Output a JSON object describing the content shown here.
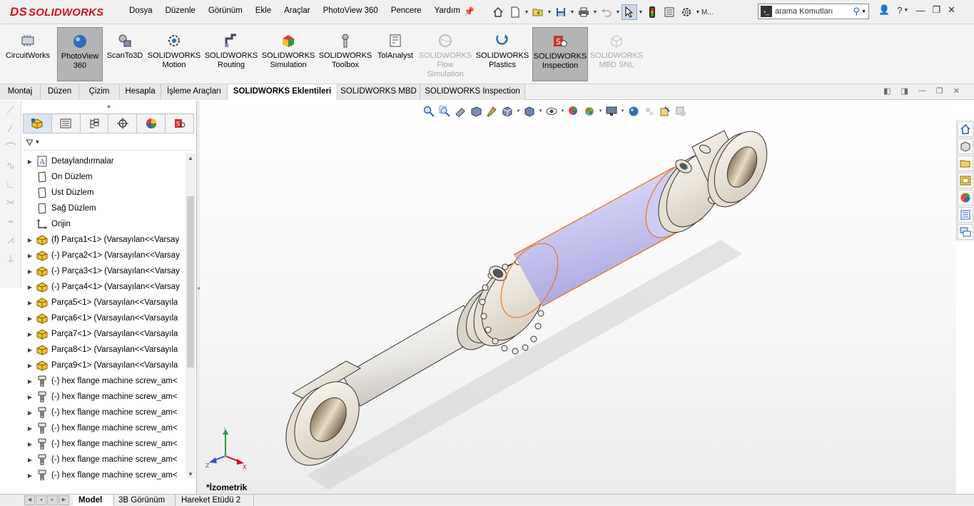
{
  "app": {
    "logo_prefix": "DS",
    "logo_text": "SOLIDWORKS"
  },
  "menu": [
    "Dosya",
    "Düzenle",
    "Görünüm",
    "Ekle",
    "Araçlar",
    "PhotoView 360",
    "Pencere",
    "Yardım"
  ],
  "quick_access": {
    "user_truncated": "M..."
  },
  "search": {
    "placeholder": "arama Komutları"
  },
  "ribbon": [
    {
      "label": "CircuitWorks",
      "state": "normal"
    },
    {
      "label": "PhotoView\n360",
      "state": "active"
    },
    {
      "label": "ScanTo3D",
      "state": "normal"
    },
    {
      "label": "SOLIDWORKS\nMotion",
      "state": "normal"
    },
    {
      "label": "SOLIDWORKS\nRouting",
      "state": "normal"
    },
    {
      "label": "SOLIDWORKS\nSimulation",
      "state": "normal"
    },
    {
      "label": "SOLIDWORKS\nToolbox",
      "state": "normal"
    },
    {
      "label": "TolAnalyst",
      "state": "normal"
    },
    {
      "label": "SOLIDWORKS\nFlow\nSimulation",
      "state": "disabled"
    },
    {
      "label": "SOLIDWORKS\nPlastics",
      "state": "normal"
    },
    {
      "label": "SOLIDWORKS\nInspection",
      "state": "active"
    },
    {
      "label": "SOLIDWORKS\nMBD SNL",
      "state": "disabled"
    }
  ],
  "command_tabs": [
    {
      "label": "Montaj",
      "active": false
    },
    {
      "label": "Düzen",
      "active": false
    },
    {
      "label": "Çizim",
      "active": false
    },
    {
      "label": "Hesapla",
      "active": false
    },
    {
      "label": "İşleme Araçları",
      "active": false
    },
    {
      "label": "SOLIDWORKS Eklentileri",
      "active": true
    },
    {
      "label": "SOLIDWORKS MBD",
      "active": false
    },
    {
      "label": "SOLIDWORKS Inspection",
      "active": false
    }
  ],
  "tree": [
    {
      "label": "Detaylandırmalar",
      "icon": "annotation-icon",
      "expandable": true
    },
    {
      "label": "Ön Düzlem",
      "icon": "plane-icon",
      "expandable": false
    },
    {
      "label": "Üst Düzlem",
      "icon": "plane-icon",
      "expandable": false
    },
    {
      "label": "Sağ Düzlem",
      "icon": "plane-icon",
      "expandable": false
    },
    {
      "label": "Orijin",
      "icon": "origin-icon",
      "expandable": false
    },
    {
      "label": "(f) Parça1<1> (Varsayılan<<Varsay",
      "icon": "part-icon",
      "expandable": true
    },
    {
      "label": "(-) Parça2<1> (Varsayılan<<Varsay",
      "icon": "part-icon",
      "expandable": true
    },
    {
      "label": "(-) Parça3<1> (Varsayılan<<Varsay",
      "icon": "part-icon",
      "expandable": true
    },
    {
      "label": "(-) Parça4<1> (Varsayılan<<Varsay",
      "icon": "part-icon",
      "expandable": true
    },
    {
      "label": "Parça5<1> (Varsayılan<<Varsayıla",
      "icon": "part-icon",
      "expandable": true
    },
    {
      "label": "Parça6<1> (Varsayılan<<Varsayıla",
      "icon": "part-icon",
      "expandable": true
    },
    {
      "label": "Parça7<1> (Varsayılan<<Varsayıla",
      "icon": "part-icon",
      "expandable": true
    },
    {
      "label": "Parça8<1> (Varsayılan<<Varsayıla",
      "icon": "part-icon",
      "expandable": true
    },
    {
      "label": "Parça9<1> (Varsayılan<<Varsayıla",
      "icon": "part-icon",
      "expandable": true
    },
    {
      "label": "(-) hex flange machine screw_am<",
      "icon": "screw-icon",
      "expandable": true
    },
    {
      "label": "(-) hex flange machine screw_am<",
      "icon": "screw-icon",
      "expandable": true
    },
    {
      "label": "(-) hex flange machine screw_am<",
      "icon": "screw-icon",
      "expandable": true
    },
    {
      "label": "(-) hex flange machine screw_am<",
      "icon": "screw-icon",
      "expandable": true
    },
    {
      "label": "(-) hex flange machine screw_am<",
      "icon": "screw-icon",
      "expandable": true
    },
    {
      "label": "(-) hex flange machine screw_am<",
      "icon": "screw-icon",
      "expandable": true
    },
    {
      "label": "(-) hex flange machine screw_am<",
      "icon": "screw-icon",
      "expandable": true
    }
  ],
  "viewport": {
    "view_label": "*İzometrik",
    "triad": {
      "x": "X",
      "y": "Y",
      "z": "Z"
    }
  },
  "bottom_tabs": [
    {
      "label": "Model",
      "active": true
    },
    {
      "label": "3B Görünüm",
      "active": false
    },
    {
      "label": "Hareket Etüdü 2",
      "active": false
    }
  ],
  "colors": {
    "brand": "#d4121b",
    "part_yellow": "#f2c12e",
    "cylinder_purple": "#c9c6f0",
    "highlight_orange": "#e8751a",
    "metal_light": "#f2ece4"
  }
}
